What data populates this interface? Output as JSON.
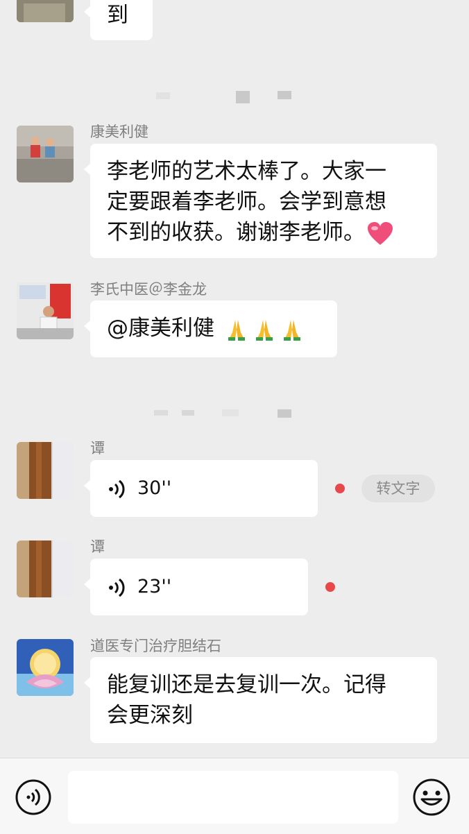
{
  "messages": [
    {
      "id": "m0",
      "sender": "",
      "lines": [
        "到"
      ]
    },
    {
      "id": "m1",
      "sender": "康美利健",
      "lines": [
        "李老师的艺术太棒了。大家一",
        "定要跟着李老师。会学到意想",
        "不到的收获。谢谢李老师。"
      ],
      "trailing_emoji": "red-heart"
    },
    {
      "id": "m2",
      "sender": "李氏中医＠李金龙",
      "text": "@康美利健",
      "trailing_emoji": "folded-hands x3"
    },
    {
      "id": "m3",
      "sender": "谭",
      "voice_duration": "30''",
      "unread": true,
      "convert_label": "转文字"
    },
    {
      "id": "m4",
      "sender": "谭",
      "voice_duration": "23''",
      "unread": true
    },
    {
      "id": "m5",
      "sender": "道医专门治疗胆结石",
      "lines": [
        "能复训还是去复训一次。记得",
        "会更深刻"
      ]
    }
  ],
  "colors": {
    "background": "#ededed",
    "bubble": "#ffffff",
    "unread_dot": "#e8484a",
    "sender_name": "#7f7f7f"
  },
  "input_bar": {
    "voice_toggle_icon": "voice-toggle-icon",
    "emoji_icon": "emoji-smile-icon",
    "text_value": ""
  }
}
